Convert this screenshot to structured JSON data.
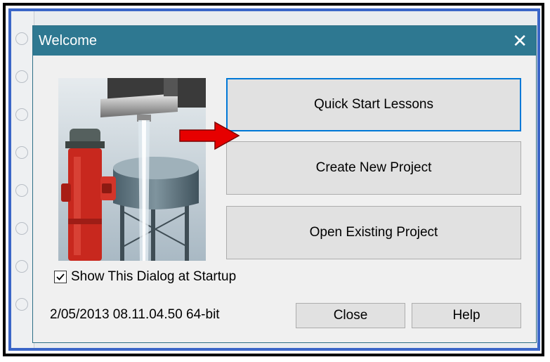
{
  "dialog": {
    "title": "Welcome",
    "close_glyph": "✕",
    "buttons": {
      "quick_start": "Quick Start Lessons",
      "create_new": "Create New Project",
      "open_existing": "Open Existing Project",
      "close": "Close",
      "help": "Help"
    },
    "show_at_startup": {
      "label": "Show This Dialog at Startup",
      "checked": true
    },
    "version_info": "2/05/2013  08.11.04.50  64-bit",
    "illustration": "fire-hydrant-faucet-water-tower-image"
  },
  "annotation": {
    "arrow_color": "#e60000",
    "arrow_target": "create-new-project-button"
  },
  "colors": {
    "titlebar": "#2e7891",
    "accent_border": "#0078d7",
    "screenshot_frame": "#3b66c8"
  }
}
